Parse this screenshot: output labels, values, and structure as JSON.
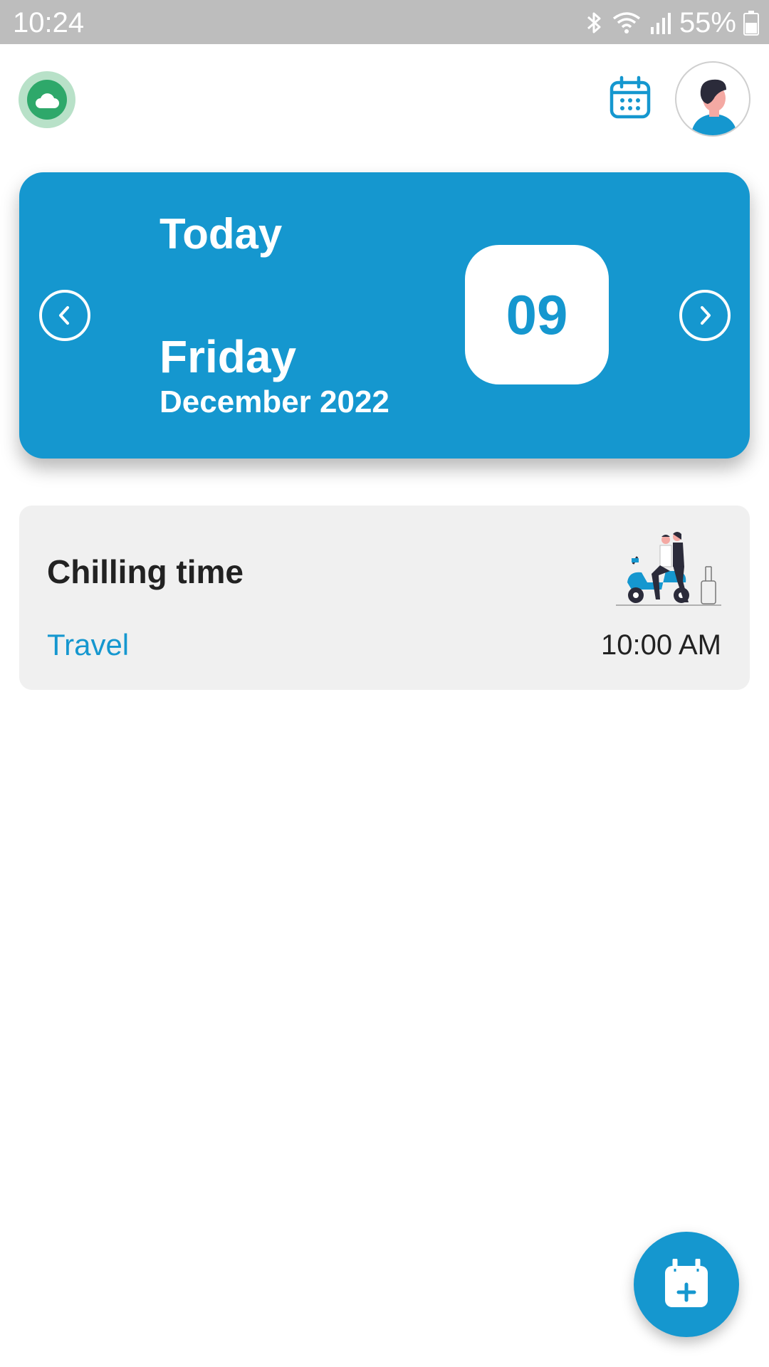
{
  "status_bar": {
    "time": "10:24",
    "battery": "55%",
    "icons": [
      "bluetooth-icon",
      "wifi-icon",
      "signal-icon",
      "battery-icon"
    ]
  },
  "header": {
    "icons": [
      "cloud-sync-icon",
      "calendar-icon",
      "avatar"
    ]
  },
  "date_card": {
    "heading": "Today",
    "weekday": "Friday",
    "month_year": "December 2022",
    "day": "09",
    "icons": [
      "chevron-left-icon",
      "chevron-right-icon"
    ]
  },
  "events": [
    {
      "title": "Chilling time",
      "category": "Travel",
      "time": "10:00 AM",
      "illustration": "scooter-couple-illustration"
    }
  ],
  "fab": {
    "icon": "add-event-icon"
  },
  "colors": {
    "accent": "#1597cf",
    "status_bar": "#bdbdbd",
    "cloud_green": "#2ea86a",
    "event_card": "#f0f0f0"
  }
}
